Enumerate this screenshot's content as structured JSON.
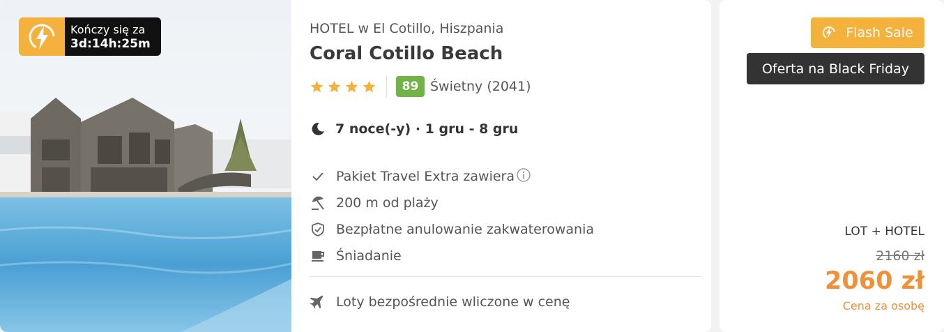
{
  "timer": {
    "label": "Kończy się za",
    "value": "3d:14h:25m"
  },
  "hotel": {
    "location": "HOTEL w El Cotillo, Hiszpania",
    "name": "Coral Cotillo Beach",
    "stars": 4,
    "score": "89",
    "score_label": "Świetny (2041)"
  },
  "dates": "7 noce(-y) · 1 gru - 8 gru",
  "features": [
    {
      "icon": "check-icon",
      "text": "Pakiet Travel Extra zawiera"
    },
    {
      "icon": "beach-umbrella-icon",
      "text": "200 m od plaży"
    },
    {
      "icon": "shield-check-icon",
      "text": "Bezpłatne anulowanie zakwaterowania"
    },
    {
      "icon": "coffee-cup-icon",
      "text": "Śniadanie"
    }
  ],
  "flights": {
    "icon": "airplane-icon",
    "text": "Loty bezpośrednie wliczone w cenę"
  },
  "price": {
    "flash_label": "Flash Sale",
    "black_friday_label": "Oferta na Black Friday",
    "package_type": "LOT + HOTEL",
    "old_price": "2160 zł",
    "new_price": "2060 zł",
    "per_person": "Cena za osobę"
  },
  "colors": {
    "accent_orange": "#f0913a",
    "flash_yellow": "#f4b13c",
    "score_green": "#71b344",
    "dark_badge": "#333333"
  }
}
